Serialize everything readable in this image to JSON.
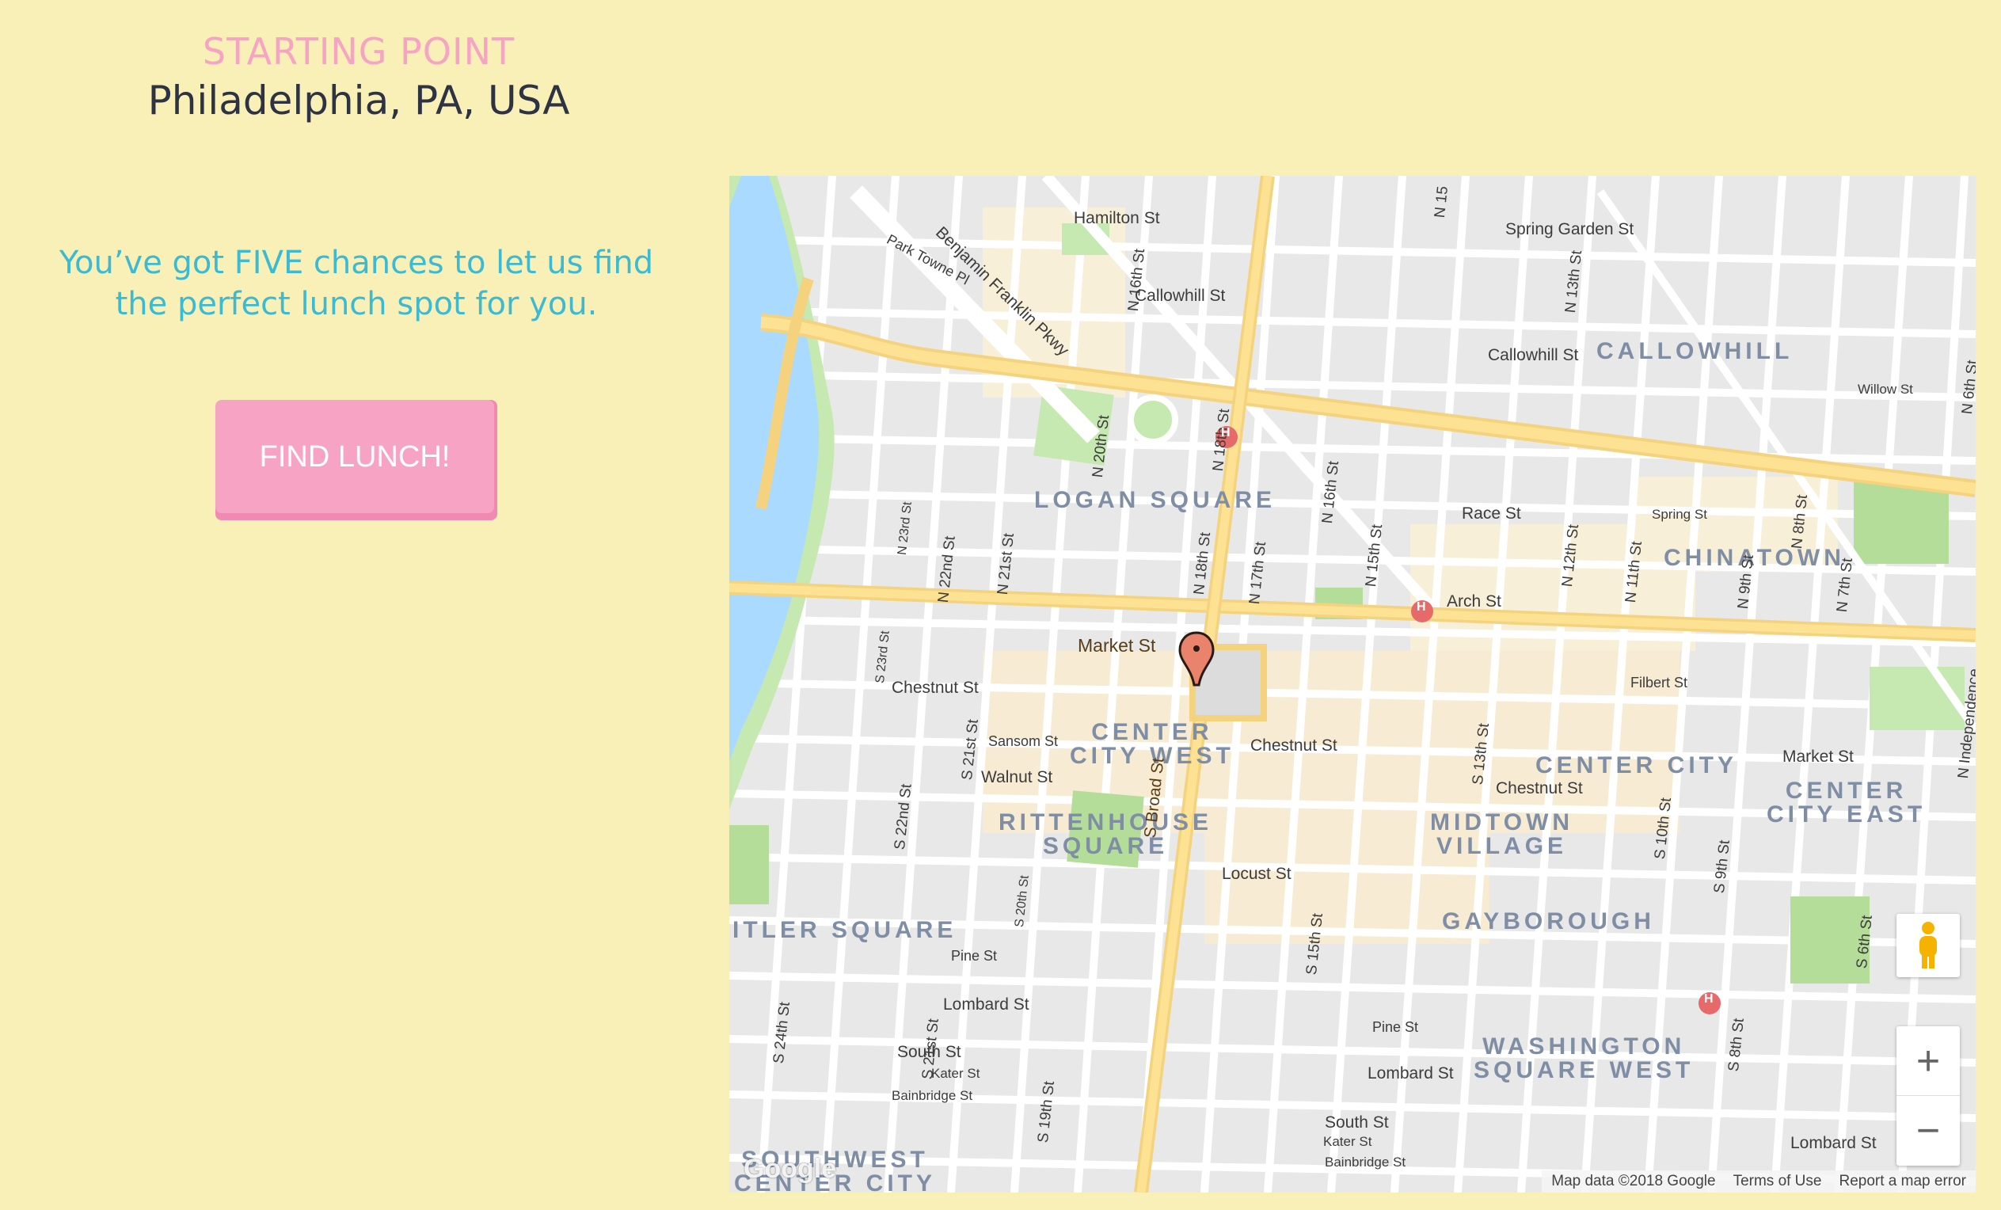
{
  "starting_point": {
    "label": "STARTING POINT",
    "city": "Philadelphia, PA, USA"
  },
  "intro": {
    "text": "You’ve got FIVE chances to let us find the perfect lunch spot for you."
  },
  "find_button": {
    "label": "FIND LUNCH!"
  },
  "map": {
    "districts": [
      "LOGAN SQUARE",
      "CALLOWHILL",
      "CHINATOWN",
      "CENTER\nCITY WEST",
      "CENTER CITY",
      "CENTER\nCITY EAST",
      "RITTENHOUSE\nSQUARE",
      "MIDTOWN\nVILLAGE",
      "GAYBOROUGH",
      "ITLER SQUARE",
      "WASHINGTON\nSQUARE WEST",
      "SOUTHWEST\nCENTER CITY"
    ],
    "streets_h": [
      "Hamilton St",
      "Callowhill St",
      "Spring Garden St",
      "Callowhill St",
      "Race St",
      "Spring St",
      "Arch St",
      "Market St",
      "Filbert St",
      "Chestnut St",
      "Sansom St",
      "Walnut St",
      "Chestnut St",
      "Chestnut St",
      "Market St",
      "Locust St",
      "Pine St",
      "Lombard St",
      "South St",
      "Kater St",
      "Bainbridge St",
      "Pine St",
      "Lombard St",
      "South St",
      "Kater St",
      "Bainbridge St",
      "Lombard St",
      "Willow St",
      "Park Towne Pl",
      "Benjamin Franklin Pkwy"
    ],
    "streets_v": [
      "N 16th St",
      "N 15",
      "N 13th St",
      "N 20th St",
      "N 18th St",
      "N 16th St",
      "N 23rd St",
      "N 22nd St",
      "N 21st St",
      "N 18th St",
      "N 17th St",
      "N 15th St",
      "N 12th St",
      "N 11th St",
      "N 9th St",
      "N 8th St",
      "N 7th St",
      "S 23rd St",
      "S 21st St",
      "S Broad St",
      "S 13th St",
      "S 10th St",
      "S 9th St",
      "S 22nd St",
      "S 20th St",
      "S 15th St",
      "S 24th St",
      "S 21st St",
      "S 19th St",
      "S 8th St",
      "S 6th St",
      "N 6th St",
      "N Independence"
    ],
    "attribution": {
      "map_data": "Map data ©2018 Google",
      "terms": "Terms of Use",
      "report": "Report a map error"
    },
    "logo": "Google",
    "zoom_in": "+",
    "zoom_out": "−",
    "marker_color": "#e9836b"
  }
}
